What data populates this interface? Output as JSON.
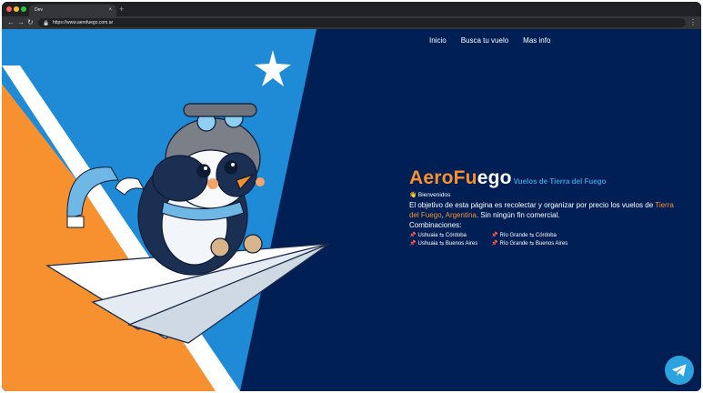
{
  "browser": {
    "tab_title": "Dev",
    "tab_close": "×",
    "new_tab": "+",
    "url": "https://www.aerofuego.com.ar",
    "nav_back": "←",
    "nav_forward": "→",
    "nav_reload": "↻",
    "menu": "⋮"
  },
  "nav": {
    "items": [
      {
        "label": "Inicio"
      },
      {
        "label": "Busca tu vuelo"
      },
      {
        "label": "Mas info"
      }
    ]
  },
  "hero": {
    "brand_part1": "AeroFu",
    "brand_part2": "ego",
    "tagline": "Vuelos de Tierra del Fuego",
    "welcome_icon": "👋",
    "welcome": "Bienvenidos",
    "description_pre": "El objetivo de esta página es recolectar y organizar por precio los vuelos de ",
    "highlight1": "Tierra del Fuego",
    "sep": ", ",
    "highlight2": "Argentina",
    "description_post": ". Sin ningún fin comercial.",
    "combinations_label": "Combinaciones:",
    "pin_icon": "📌",
    "routes": [
      {
        "label": "Ushuaia ⇆ Córdoba"
      },
      {
        "label": "Río Grande ⇆ Córdoba"
      },
      {
        "label": "Ushuaia ⇆ Buenos Aires"
      },
      {
        "label": "Río Grande ⇆ Buenos Aires"
      }
    ]
  },
  "colors": {
    "page_bg": "#001f54",
    "brand_orange": "#f7912f",
    "tagline_blue": "#3a9ad9",
    "flag_orange": "#f7912f",
    "flag_blue": "#1f8ad6",
    "telegram_blue": "#2aa3df"
  },
  "icons": {
    "lock": "lock-icon",
    "star": "star-icon",
    "telegram": "telegram-icon",
    "illustration": "penguin-pilot-on-paper-plane"
  }
}
